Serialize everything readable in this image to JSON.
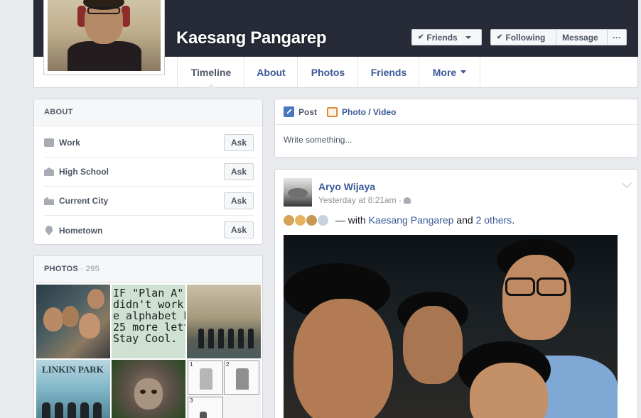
{
  "profile": {
    "name": "Kaesang Pangarep",
    "actions": {
      "friends": "Friends",
      "following": "Following",
      "message": "Message",
      "more": "···"
    }
  },
  "nav": {
    "tabs": [
      {
        "label": "Timeline",
        "active": true
      },
      {
        "label": "About"
      },
      {
        "label": "Photos"
      },
      {
        "label": "Friends"
      },
      {
        "label": "More"
      }
    ]
  },
  "about": {
    "heading": "ABOUT",
    "ask_label": "Ask",
    "rows": [
      {
        "label": "Work",
        "icon": "briefcase-icon"
      },
      {
        "label": "High School",
        "icon": "school-icon"
      },
      {
        "label": "Current City",
        "icon": "city-icon"
      },
      {
        "label": "Hometown",
        "icon": "location-pin-icon"
      }
    ]
  },
  "photos": {
    "heading": "PHOTOS",
    "separator": " · ",
    "count": "295",
    "thumb_texts": {
      "plan_a": "IF \"Plan A\"\ndidn't work.\ne alphabet has\n25 more letter\nStay Cool.",
      "band": "LINKIN PARK",
      "panel_numbers": [
        "1",
        "2",
        "3"
      ]
    }
  },
  "composer": {
    "post_tab": "Post",
    "photo_tab": "Photo / Video",
    "placeholder": "Write something..."
  },
  "story": {
    "author": "Aryo Wijaya",
    "timestamp": "Yesterday at 8:21am",
    "meta_sep": " · ",
    "audience_icon": "friends-icon",
    "with_text": " — with ",
    "tagged": "Kaesang Pangarep",
    "and_text": " and ",
    "others": "2 others",
    "period": "."
  },
  "colors": {
    "link": "#3b5998",
    "cover": "#262b37",
    "page_bg": "#e9eaed"
  }
}
